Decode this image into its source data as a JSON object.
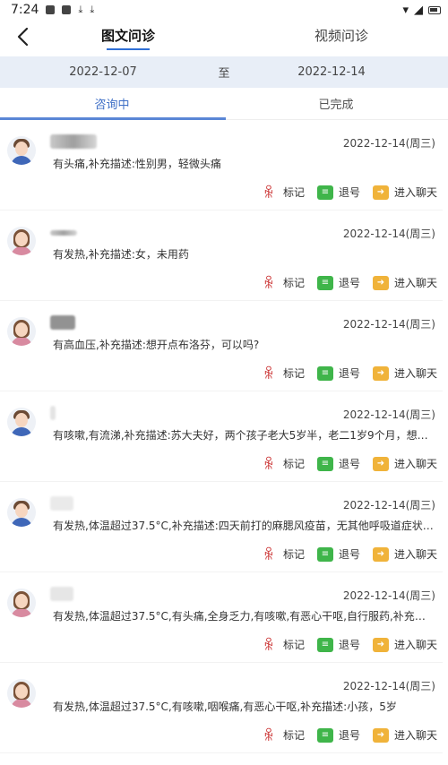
{
  "status": {
    "time": "7:24"
  },
  "tabs": [
    {
      "label": "图文问诊"
    },
    {
      "label": "视频问诊"
    }
  ],
  "daterange": {
    "start": "2022-12-07",
    "sep": "至",
    "end": "2022-12-14"
  },
  "subtabs": [
    {
      "label": "咨询中"
    },
    {
      "label": "已完成"
    }
  ],
  "actions": {
    "mark": "标记",
    "refund": "退号",
    "chat": "进入聊天"
  },
  "icons": {
    "back": "chevron-left-icon",
    "mark": "people-mark-icon",
    "refund": "list-icon",
    "chat": "arrow-right-icon"
  },
  "cards": [
    {
      "gender": "male",
      "date": "2022-12-14(周三)",
      "desc": "有头痛,补充描述:性别男，轻微头痛"
    },
    {
      "gender": "female",
      "date": "2022-12-14(周三)",
      "desc": "有发热,补充描述:女，未用药"
    },
    {
      "gender": "female",
      "date": "2022-12-14(周三)",
      "desc": "有高血压,补充描述:想开点布洛芬，可以吗?"
    },
    {
      "gender": "male",
      "date": "2022-12-14(周三)",
      "desc": "有咳嗽,有流涕,补充描述:苏大夫好，两个孩子老大5岁半，老二1岁9个月，想给孩..."
    },
    {
      "gender": "male",
      "date": "2022-12-14(周三)",
      "desc": "有发热,体温超过37.5°C,补充描述:四天前打的麻腮风疫苗，无其他呼吸道症状，想..."
    },
    {
      "gender": "female",
      "date": "2022-12-14(周三)",
      "desc": "有发热,体温超过37.5°C,有头痛,全身乏力,有咳嗽,有恶心干呕,自行服药,补充描述:发..."
    },
    {
      "gender": "female",
      "date": "2022-12-14(周三)",
      "desc": "有发热,体温超过37.5°C,有咳嗽,咽喉痛,有恶心干呕,补充描述:小孩，5岁"
    }
  ]
}
